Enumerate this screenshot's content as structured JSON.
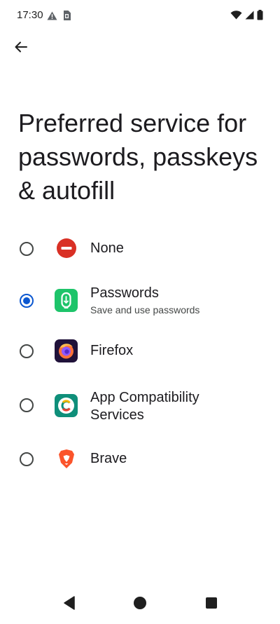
{
  "status_bar": {
    "time": "17:30",
    "left_icons": [
      "warning-icon",
      "sim-card-icon"
    ],
    "right_icons": [
      "wifi-icon",
      "signal-icon",
      "battery-icon"
    ]
  },
  "header": {
    "back_icon": "arrow-back-icon"
  },
  "title": "Preferred service for passwords, passkeys & autofill",
  "options": [
    {
      "label": "None",
      "subtitle": "",
      "icon": "none-icon",
      "selected": false
    },
    {
      "label": "Passwords",
      "subtitle": "Save and use passwords",
      "icon": "passwords-app-icon",
      "selected": true
    },
    {
      "label": "Firefox",
      "subtitle": "",
      "icon": "firefox-icon",
      "selected": false
    },
    {
      "label": "App Compatibility Services",
      "label_line1": "App Compatibility",
      "label_line2": "Services",
      "subtitle": "",
      "icon": "app-compatibility-icon",
      "selected": false
    },
    {
      "label": "Brave",
      "subtitle": "",
      "icon": "brave-icon",
      "selected": false
    }
  ],
  "nav_bar": {
    "buttons": [
      "back-triangle-icon",
      "home-circle-icon",
      "recents-square-icon"
    ]
  },
  "colors": {
    "accent": "#0b57d0",
    "none_red": "#d93025",
    "passwords_green": "#1ec46a",
    "appcompat_teal": "#0f8f7a",
    "brave_orange": "#fb542b"
  }
}
